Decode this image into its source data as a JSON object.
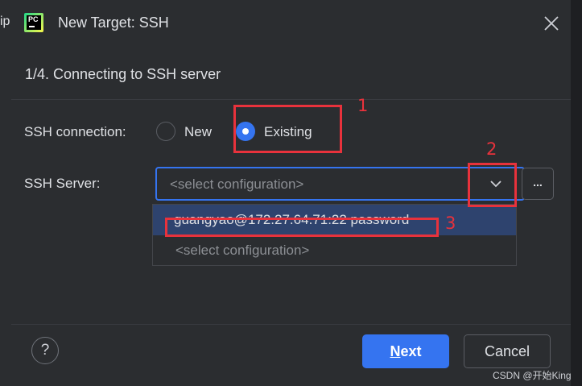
{
  "background": {
    "left_text": "ip"
  },
  "dialog": {
    "title": "New Target: SSH",
    "app_icon": "pycharm-logo",
    "app_icon_text": "PC",
    "step_title": "1/4. Connecting to SSH server"
  },
  "form": {
    "ssh_connection_label": "SSH connection:",
    "radio_new_label": "New",
    "radio_existing_label": "Existing",
    "selected_option": "Existing",
    "ssh_server_label": "SSH Server:",
    "combo_value": "<select configuration>",
    "browse_label": "..."
  },
  "dropdown": {
    "items": [
      "guangyao@172.27.64.71:22 password",
      "<select configuration>"
    ],
    "selected_index": 0
  },
  "annotations": [
    "1",
    "2",
    "3"
  ],
  "footer": {
    "help_label": "?",
    "next_mnemonic": "N",
    "next_rest": "ext",
    "cancel_label": "Cancel"
  },
  "watermark": "CSDN @开始King",
  "colors": {
    "accent": "#3574f0",
    "annotation": "#e8323c",
    "selection": "#2e436e",
    "background": "#2b2d30"
  }
}
